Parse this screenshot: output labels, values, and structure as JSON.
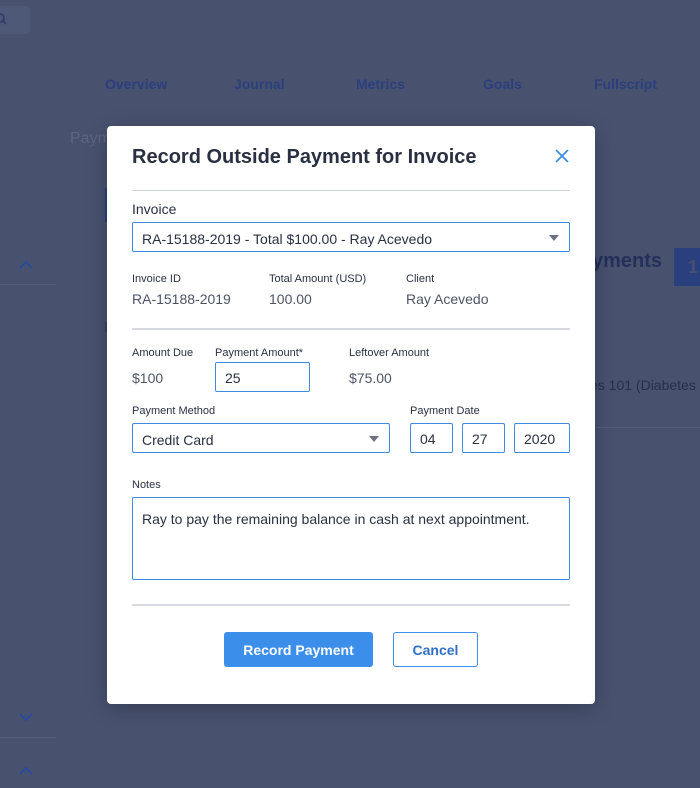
{
  "background": {
    "nav": [
      "Overview",
      "Journal",
      "Metrics",
      "Goals",
      "Fullscript"
    ],
    "left_text": "Paym",
    "right_title": "yments",
    "right_badge": "1",
    "right_text": "es 101 (Diabetes"
  },
  "modal": {
    "title": "Record Outside Payment for Invoice",
    "invoice": {
      "label": "Invoice",
      "selected": "RA-15188-2019 - Total $100.00 - Ray Acevedo"
    },
    "details": {
      "invoice_id_label": "Invoice ID",
      "invoice_id": "RA-15188-2019",
      "total_label": "Total Amount (USD)",
      "total": "100.00",
      "client_label": "Client",
      "client": "Ray Acevedo"
    },
    "payment": {
      "amount_due_label": "Amount Due",
      "amount_due": "$100",
      "payment_amount_label": "Payment Amount*",
      "payment_amount": "25",
      "leftover_label": "Leftover Amount",
      "leftover": "$75.00"
    },
    "method": {
      "label": "Payment Method",
      "selected": "Credit Card"
    },
    "date": {
      "label": "Payment Date",
      "month": "04",
      "day": "27",
      "year": "2020"
    },
    "notes": {
      "label": "Notes",
      "value": "Ray to pay the remaining balance in cash at next appointment."
    },
    "buttons": {
      "record": "Record Payment",
      "cancel": "Cancel"
    }
  },
  "colors": {
    "accent": "#3b8eea",
    "overlay": "#48526f"
  }
}
